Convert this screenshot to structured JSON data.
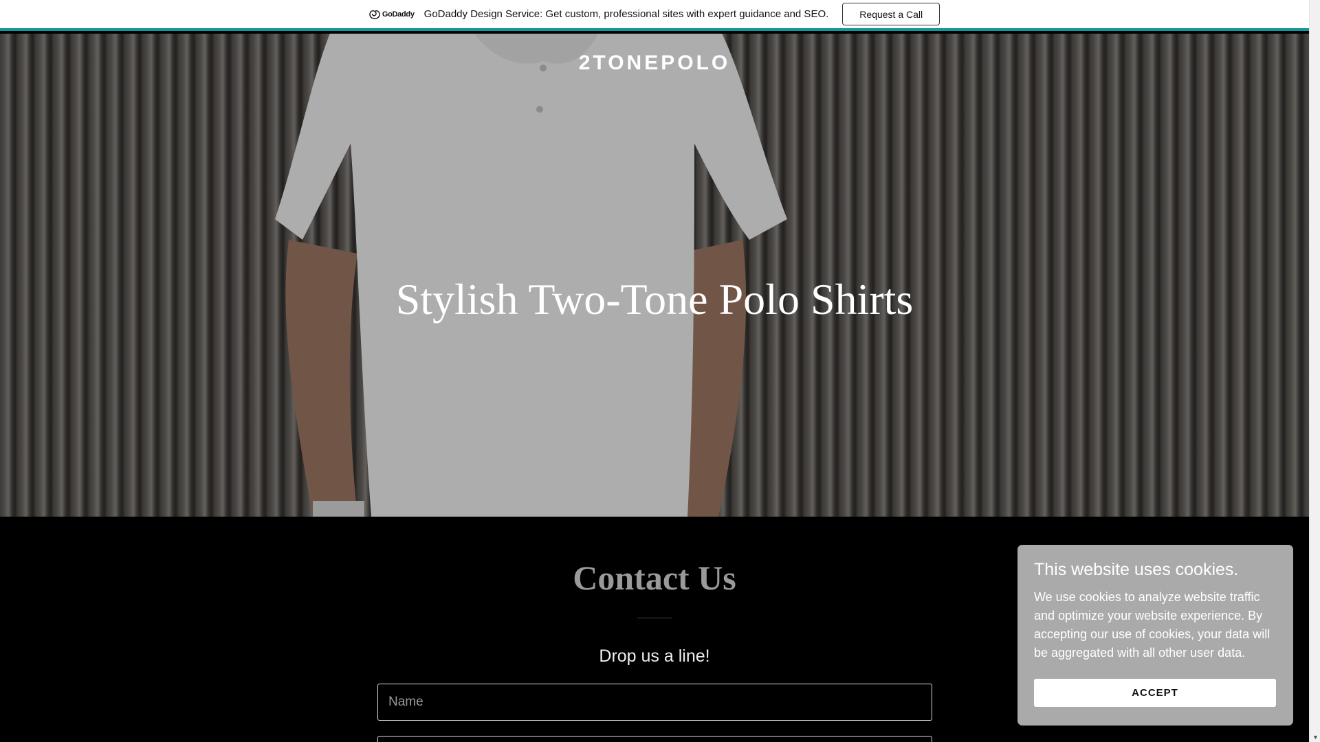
{
  "promo": {
    "logo_text": "GoDaddy",
    "message": "GoDaddy Design Service: Get custom, professional sites with expert guidance and SEO.",
    "cta_label": "Request a Call",
    "accent_color": "#14999a"
  },
  "header": {
    "site_title": "2TONEPOLO"
  },
  "hero": {
    "heading": "Stylish Two-Tone Polo Shirts"
  },
  "contact": {
    "title": "Contact Us",
    "subtitle": "Drop us a line!",
    "name_placeholder": "Name",
    "email_placeholder": ""
  },
  "cookie": {
    "title": "This website uses cookies.",
    "body": "We use cookies to analyze website traffic and optimize your website experience. By accepting our use of cookies, your data will be aggregated with all other user data.",
    "accept_label": "ACCEPT"
  },
  "icons": [
    "godaddy-logo-icon",
    "scroll-down-icon"
  ]
}
